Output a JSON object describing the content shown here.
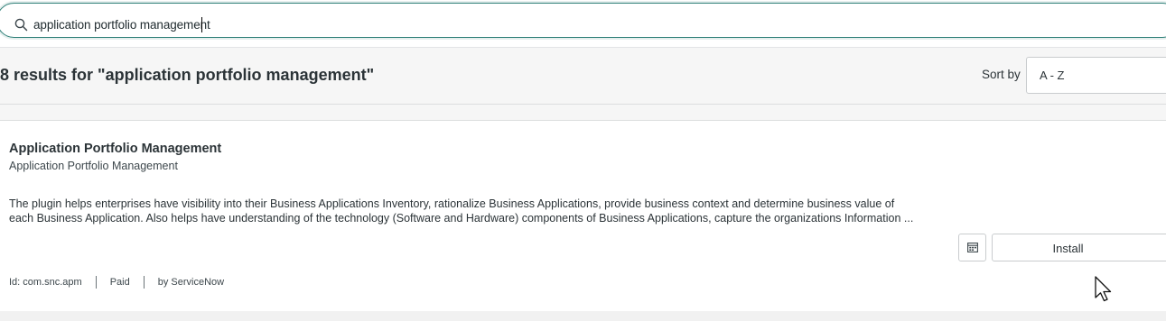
{
  "search": {
    "value": "application portfolio management"
  },
  "results": {
    "title": "8 results for \"application portfolio management\"",
    "sort_label": "Sort by",
    "sort_value": "A - Z"
  },
  "card": {
    "title": "Application Portfolio Management",
    "subtitle": "Application Portfolio Management",
    "description_lines": [
      "The plugin helps enterprises have visibility into their Business Applications Inventory, rationalize Business Applications, provide business context and determine business value of",
      "each Business Application. Also helps have understanding of the technology (Software and Hardware) components of Business Applications, capture the organizations Information ..."
    ],
    "install_label": "Install",
    "meta": {
      "id": "Id: com.snc.apm",
      "pricing": "Paid",
      "vendor": "by ServiceNow"
    }
  },
  "icons": {
    "search": "search-icon",
    "details": "calendar-grid-icon",
    "cursor": "mouse-pointer-icon"
  },
  "colors": {
    "search_border": "#2e7f77",
    "text": "#2b3337",
    "background": "#f4f4f4"
  }
}
